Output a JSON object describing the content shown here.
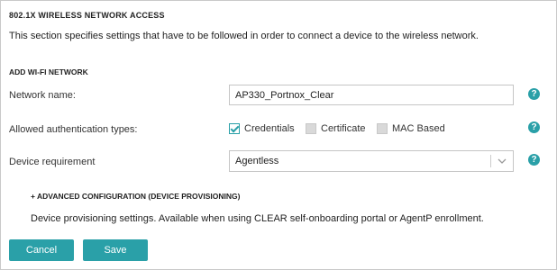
{
  "section": {
    "title": "802.1X WIRELESS NETWORK ACCESS",
    "description": "This section specifies settings that have to be followed in order to connect a device to the wireless network."
  },
  "add_wifi": {
    "title": "ADD WI-FI NETWORK",
    "network_name": {
      "label": "Network name:",
      "value": "AP330_Portnox_Clear"
    },
    "auth_types": {
      "label": "Allowed authentication types:",
      "options": [
        {
          "label": "Credentials",
          "checked": true,
          "disabled": false
        },
        {
          "label": "Certificate",
          "checked": false,
          "disabled": true
        },
        {
          "label": "MAC Based",
          "checked": false,
          "disabled": true
        }
      ]
    },
    "device_requirement": {
      "label": "Device requirement",
      "selected": "Agentless"
    },
    "help_icon": "?"
  },
  "advanced": {
    "toggle_label": "+ ADVANCED CONFIGURATION (DEVICE PROVISIONING)",
    "description": "Device provisioning settings. Available when using CLEAR self-onboarding portal or AgentP enrollment."
  },
  "buttons": {
    "cancel": "Cancel",
    "save": "Save"
  },
  "colors": {
    "accent": "#2aa0a8",
    "border": "#c5c5c5",
    "disabled_checkbox": "#d9d9d9"
  }
}
